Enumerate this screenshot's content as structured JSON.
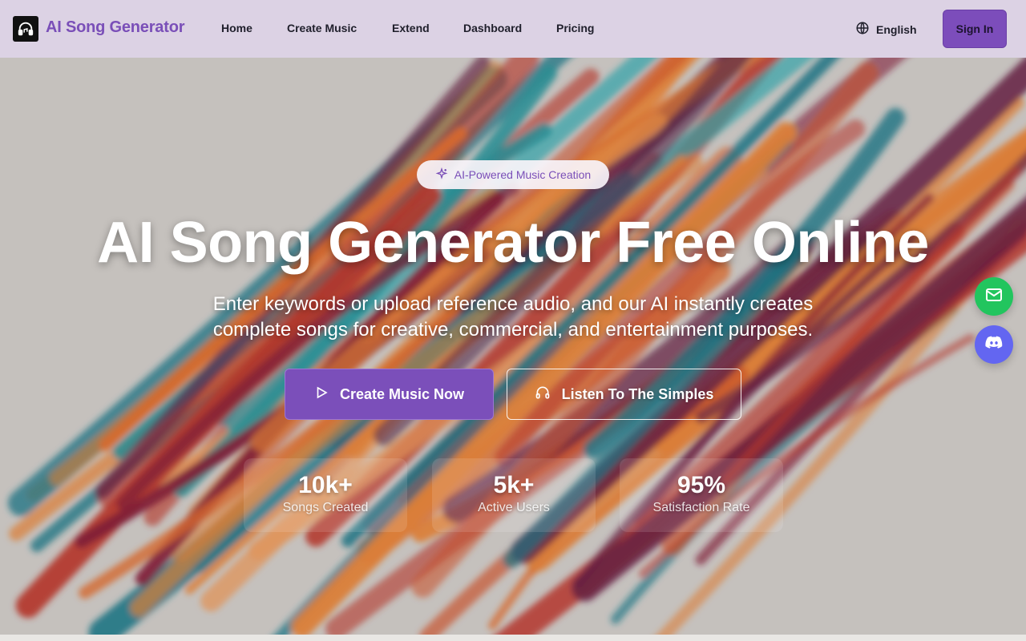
{
  "header": {
    "brand": "AI Song Generator",
    "nav": [
      {
        "label": "Home"
      },
      {
        "label": "Create Music"
      },
      {
        "label": "Extend"
      },
      {
        "label": "Dashboard"
      },
      {
        "label": "Pricing"
      }
    ],
    "language": "English",
    "signin_label": "Sign In"
  },
  "hero": {
    "badge": "AI-Powered Music Creation",
    "title": "AI Song Generator Free Online",
    "subtitle_line1": "Enter keywords or upload reference audio, and our AI instantly creates",
    "subtitle_line2": "complete songs for creative, commercial, and entertainment purposes.",
    "primary_cta": "Create Music Now",
    "secondary_cta": "Listen To The Simples",
    "stats": [
      {
        "value": "10k+",
        "label": "Songs Created"
      },
      {
        "value": "5k+",
        "label": "Active Users"
      },
      {
        "value": "95%",
        "label": "Satisfaction Rate"
      }
    ]
  },
  "floating": {
    "email_icon": "mail-icon",
    "discord_icon": "discord-icon"
  },
  "colors": {
    "brand_purple": "#7b4fba",
    "header_bg": "#dcd2e4",
    "email_green": "#22c55e",
    "discord_indigo": "#6366f1"
  }
}
